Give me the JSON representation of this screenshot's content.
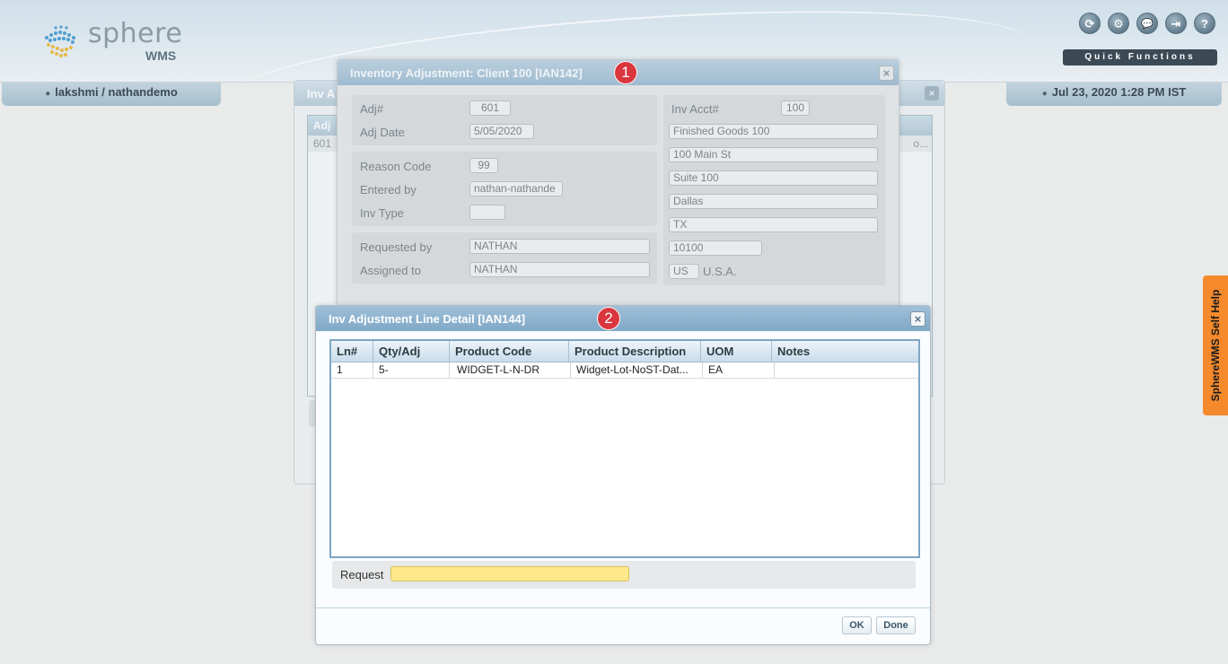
{
  "header": {
    "logo_word": "sphere",
    "logo_sub": "WMS",
    "icons": [
      {
        "name": "refresh-icon",
        "glyph": "⟳"
      },
      {
        "name": "gear-icon",
        "glyph": "⚙"
      },
      {
        "name": "chat-icon",
        "glyph": "💬"
      },
      {
        "name": "logout-icon",
        "glyph": "⇥"
      },
      {
        "name": "help-icon",
        "glyph": "?"
      }
    ],
    "quick_functions": "Quick Functions",
    "user": "lakshmi / nathandemo",
    "datetime": "Jul 23, 2020 1:28 PM IST"
  },
  "background_panel": {
    "title": "Inv A",
    "grid_header": "Adj",
    "grid_row": "601",
    "truncated": "o..."
  },
  "adjustment_dialog": {
    "title": "Inventory Adjustment: Client 100 [IAN142]",
    "badge": "1",
    "close": "×",
    "adj_no_label": "Adj#",
    "adj_no": "601",
    "adj_date_label": "Adj Date",
    "adj_date": "5/05/2020",
    "reason_code_label": "Reason Code",
    "reason_code": "99",
    "entered_by_label": "Entered by",
    "entered_by": "nathan-nathande",
    "inv_type_label": "Inv Type",
    "inv_type": "",
    "requested_by_label": "Requested by",
    "requested_by": "NATHAN",
    "assigned_to_label": "Assigned to",
    "assigned_to": "NATHAN",
    "inv_acct_label": "Inv Acct#",
    "inv_acct": "100",
    "acct_name": "Finished Goods 100",
    "address1": "100 Main St",
    "address2": "Suite 100",
    "city": "Dallas",
    "state": "TX",
    "zip": "10100",
    "country_code": "US",
    "country_name": "U.S.A."
  },
  "line_detail_dialog": {
    "title": "Inv Adjustment Line Detail [IAN144]",
    "badge": "2",
    "close": "×",
    "columns": [
      "Ln#",
      "Qty/Adj",
      "Product Code",
      "Product Description",
      "UOM",
      "Notes"
    ],
    "rows": [
      [
        "1",
        "5-",
        "WIDGET-L-N-DR",
        "Widget-Lot-NoST-Dat...",
        "EA",
        ""
      ]
    ],
    "request_label": "Request",
    "request_value": "",
    "ok_label": "OK",
    "done_label": "Done"
  },
  "self_help": "SphereWMS Self Help"
}
